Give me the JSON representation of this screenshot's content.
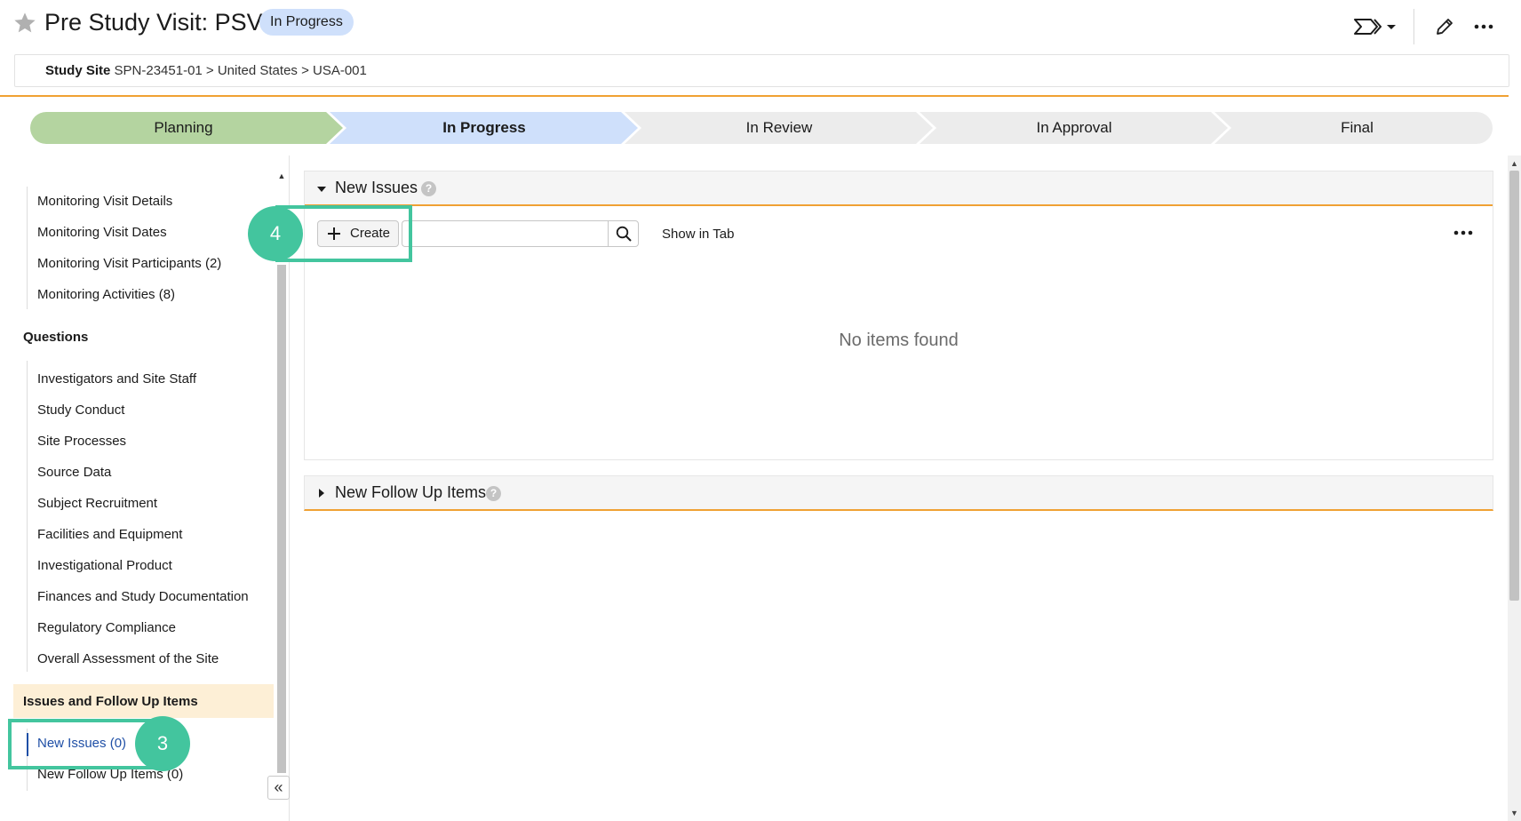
{
  "header": {
    "title": "Pre Study Visit: PSV",
    "status": "In Progress",
    "breadcrumb_label": "Study Site",
    "breadcrumb_path": "SPN-23451-01 > United States > USA-001"
  },
  "stages": [
    {
      "label": "Planning",
      "state": "complete"
    },
    {
      "label": "In Progress",
      "state": "current"
    },
    {
      "label": "In Review",
      "state": "upcoming"
    },
    {
      "label": "In Approval",
      "state": "upcoming"
    },
    {
      "label": "Final",
      "state": "upcoming"
    }
  ],
  "nav": {
    "top_items": [
      "Monitoring Visit Details",
      "Monitoring Visit Dates",
      "Monitoring Visit Participants (2)",
      "Monitoring Activities (8)"
    ],
    "questions_heading": "Questions",
    "question_items": [
      "Investigators and Site Staff",
      "Study Conduct",
      "Site Processes",
      "Source Data",
      "Subject Recruitment",
      "Facilities and Equipment",
      "Investigational Product",
      "Finances and Study Documentation",
      "Regulatory Compliance",
      "Overall Assessment of the Site"
    ],
    "issues_heading": "Issues and Follow Up Items",
    "issue_items": [
      "New Issues (0)",
      "New Follow Up Items (0)"
    ],
    "collapse_glyph": "«"
  },
  "sections": {
    "new_issues": {
      "title": "New Issues",
      "create_label": "Create",
      "search_value": "",
      "show_in_tab_label": "Show in Tab",
      "empty_message": "No items found"
    },
    "follow_up": {
      "title": "New Follow Up Items"
    }
  },
  "callouts": {
    "step_create": "4",
    "step_nav": "3"
  },
  "colors": {
    "accent_orange": "#f0a133",
    "planning_green": "#b4d4a0",
    "current_blue": "#cfe0fb",
    "upcoming_gray": "#ececec",
    "callout_green": "#43c59e",
    "link_blue": "#1f4fa6"
  },
  "icons": {
    "favorite": "star-icon",
    "path": "chevron-path-icon",
    "edit": "pencil-icon",
    "more": "more-dots-icon",
    "search": "search-icon",
    "help": "help-icon"
  }
}
